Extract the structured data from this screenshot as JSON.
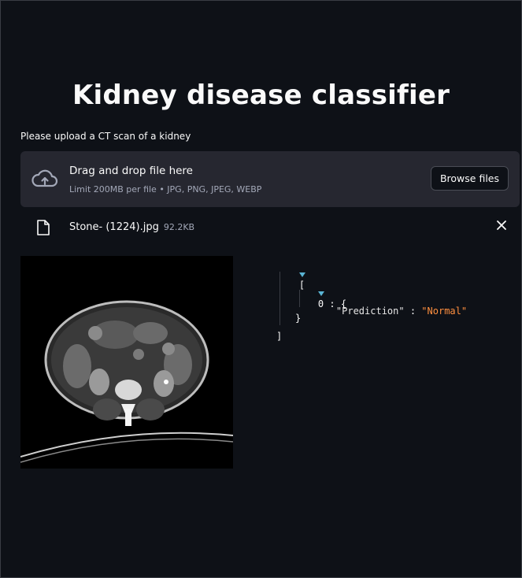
{
  "page": {
    "title": "Kidney disease classifier"
  },
  "uploader": {
    "label": "Please upload a CT scan of a kidney",
    "dropzone_title": "Drag and drop file here",
    "dropzone_subtitle": "Limit 200MB per file • JPG, PNG, JPEG, WEBP",
    "browse_label": "Browse files",
    "icon": "cloud-upload-icon"
  },
  "uploaded_file": {
    "name": "Stone- (1224).jpg",
    "size": "92.2KB",
    "icon": "file-icon",
    "remove_icon": "close-icon"
  },
  "json_viewer": {
    "open_bracket": "[",
    "index": "0",
    "colon": " : ",
    "open_brace": "{",
    "key": "\"Prediction\"",
    "value": "\"Normal\"",
    "close_brace": "}",
    "close_bracket": "]"
  },
  "colors": {
    "background": "#0e1117",
    "dropzone": "#262730",
    "string_value": "#ff8f3f",
    "caret": "#5ab4d4"
  }
}
